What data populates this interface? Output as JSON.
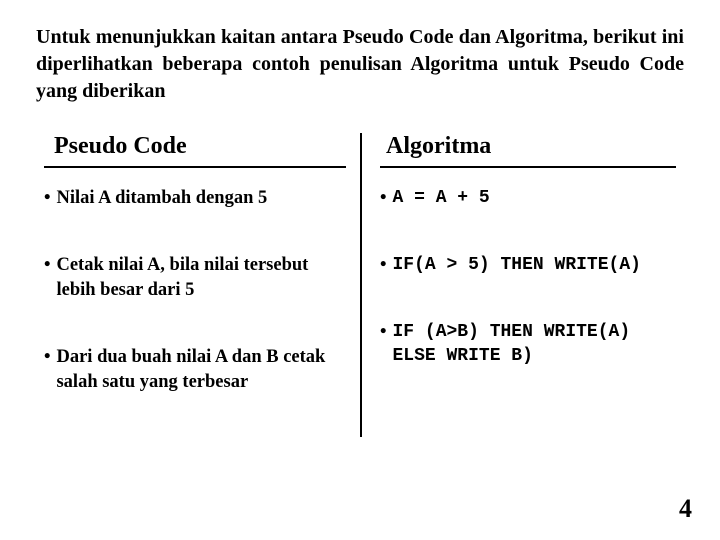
{
  "intro": "Untuk menunjukkan kaitan antara Pseudo Code dan Algoritma, berikut ini diperlihatkan  beberapa contoh penulisan Algoritma untuk Pseudo Code yang diberikan",
  "columns": {
    "left": {
      "title": "Pseudo Code"
    },
    "right": {
      "title": "Algoritma"
    }
  },
  "rows": [
    {
      "pseudo": "Nilai A ditambah dengan 5",
      "algo": "A = A + 5"
    },
    {
      "pseudo": "Cetak nilai A, bila nilai tersebut lebih besar dari 5",
      "algo": "IF(A > 5) THEN WRITE(A)"
    },
    {
      "pseudo": "Dari dua buah nilai A dan B cetak salah satu yang terbesar",
      "algo": "IF (A>B) THEN WRITE(A) ELSE WRITE B)"
    }
  ],
  "bullet": "•",
  "page_number": "4"
}
